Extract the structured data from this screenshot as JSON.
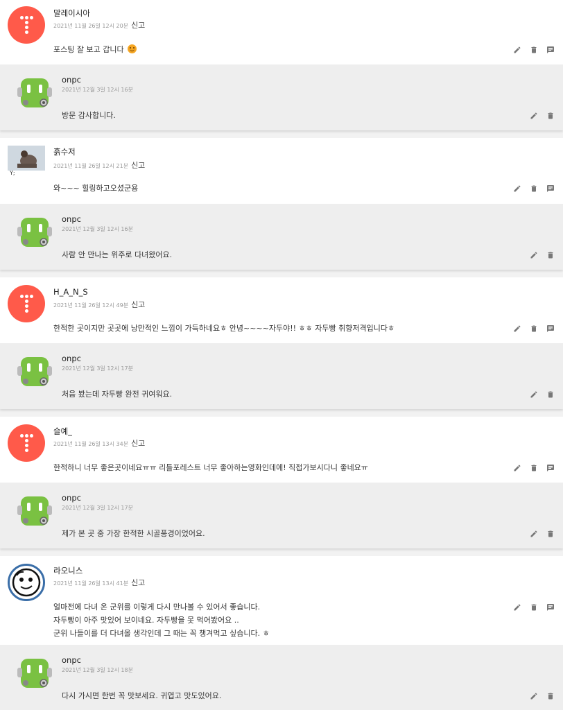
{
  "comments": [
    {
      "author": "말레이시아",
      "date": "2021년 11월 26일 12시 20분",
      "report": "신고",
      "text": "포스팅 잘 보고 갑니다",
      "reply": {
        "author": "onpc",
        "date": "2021년 12월 3일 12시 16분",
        "text": "방문 감사합니다."
      }
    },
    {
      "author": "흙수저",
      "date": "2021년 11월 26일 12시 21분",
      "report": "신고",
      "text": "와~~~ 힐링하고오셨군용",
      "avatar_caption": "Y;",
      "reply": {
        "author": "onpc",
        "date": "2021년 12월 3일 12시 16분",
        "text": "사람 안 만나는 위주로 다녀왔어요."
      }
    },
    {
      "author": "H_A_N_S",
      "date": "2021년 11월 26일 12시 49분",
      "report": "신고",
      "text": "한적한 곳이지만 곳곳에 낭만적인 느낌이 가득하네요ㅎ 안녕~~~~자두야!! ㅎㅎ 자두빵 취향저격입니다ㅎ",
      "reply": {
        "author": "onpc",
        "date": "2021년 12월 3일 12시 17분",
        "text": "처음 봤는데 자두빵 완전 귀여워요."
      }
    },
    {
      "author": "슬예_",
      "date": "2021년 11월 26일 13시 34분",
      "report": "신고",
      "text": "한적하니 너무 좋은곳이네요ㅠㅠ 리틀포레스트 너무 좋아하는영화인데에! 직접가보시다니 좋네요ㅠ",
      "reply": {
        "author": "onpc",
        "date": "2021년 12월 3일 12시 17분",
        "text": "제가 본 곳 중 가장 한적한 시골풍경이었어요."
      }
    },
    {
      "author": "라오니스",
      "date": "2021년 11월 26일 13시 41분",
      "report": "신고",
      "text": "얼마전에 다녀 온 군위를 이렇게 다시 만나볼 수 있어서 좋습니다.\n자두빵이 아주 맛있어 보이네요. 자두빵을 못 먹어봤어요 ..\n군위 나들이를 더 다녀올 생각인데 그 때는 꼭 챙겨먹고 싶습니다. ㅎ",
      "reply": {
        "author": "onpc",
        "date": "2021년 12월 3일 12시 18분",
        "text": "다시 가시면 한번 꼭 맛보세요. 귀엽고 맛도있어요."
      }
    }
  ],
  "icons": {
    "edit": "pencil-icon",
    "delete": "trash-icon",
    "reply": "message-icon"
  },
  "colors": {
    "tistory_avatar": "#ff5a4a",
    "reply_bg": "#eeeeee",
    "robot_green": "#7ac142"
  }
}
